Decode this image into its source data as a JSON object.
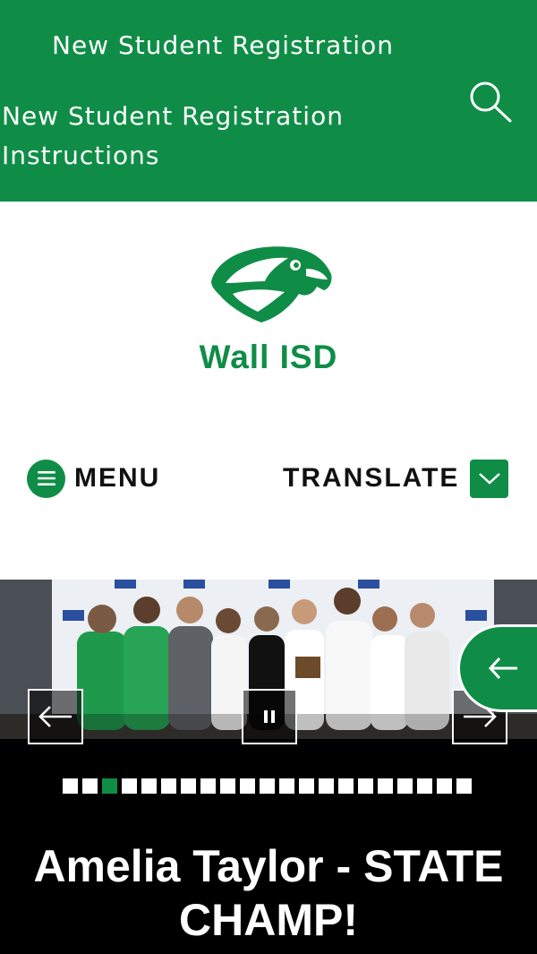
{
  "header": {
    "link_primary": "New Student Registration",
    "link_secondary": "New Student Registration Instructions",
    "search_icon": "search-icon"
  },
  "site": {
    "title": "Wall ISD",
    "logo": "eagle-head-logo"
  },
  "nav": {
    "menu_label": "MENU",
    "menu_icon": "hamburger-icon",
    "translate_label": "TRANSLATE",
    "translate_icon": "chevron-down-icon"
  },
  "slideshow": {
    "caption": "Amelia Taylor - STATE CHAMP!",
    "total_slides": 21,
    "active_slide": 3,
    "prev_icon": "arrow-left-icon",
    "pause_icon": "pause-icon",
    "next_icon": "arrow-right-icon"
  },
  "side_tab": {
    "icon": "arrow-left-icon"
  },
  "colors": {
    "brand_green": "#0f8d47",
    "black": "#000000",
    "white": "#ffffff"
  }
}
